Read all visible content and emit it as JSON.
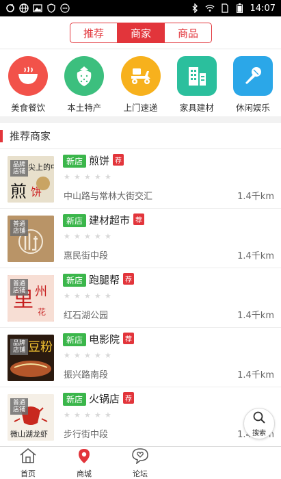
{
  "status_bar": {
    "time": "14:07",
    "left_icons": [
      "sync-icon",
      "globe-icon",
      "image-icon",
      "shield-icon",
      "more-icon"
    ],
    "right_icons": [
      "bluetooth-icon",
      "wifi-icon",
      "sim-icon",
      "battery-icon"
    ]
  },
  "segments": {
    "items": [
      {
        "label": "推荐",
        "active": false
      },
      {
        "label": "商家",
        "active": true
      },
      {
        "label": "商品",
        "active": false
      }
    ]
  },
  "categories": [
    {
      "label": "美食餐饮",
      "icon": "bowl-icon",
      "color": "#f2524a"
    },
    {
      "label": "本土特产",
      "icon": "strawberry-icon",
      "color": "#3cbf7e"
    },
    {
      "label": "上门速递",
      "icon": "scooter-icon",
      "color": "#f7b11d"
    },
    {
      "label": "家具建材",
      "icon": "building-icon",
      "color": "#2bbf9d"
    },
    {
      "label": "休闲娱乐",
      "icon": "microphone-icon",
      "color": "#2ba7e8"
    }
  ],
  "section": {
    "title": "推荐商家"
  },
  "merchants": [
    {
      "tag": "品牌店铺",
      "new": "新店",
      "name": "煎饼",
      "rec": "荐",
      "address": "中山路与常林大街交汇",
      "distance": "1.4千km",
      "thumb_color": "#d9cfb8"
    },
    {
      "tag": "普通店铺",
      "new": "新店",
      "name": "建材超市",
      "rec": "荐",
      "address": "惠民街中段",
      "distance": "1.4千km",
      "thumb_color": "#b99467"
    },
    {
      "tag": "普通店铺",
      "new": "新店",
      "name": "跑腿帮",
      "rec": "荐",
      "address": "红石湖公园",
      "distance": "1.4千km",
      "thumb_color": "#c61f1f"
    },
    {
      "tag": "品牌店铺",
      "new": "新店",
      "name": "电影院",
      "rec": "荐",
      "address": "振兴路南段",
      "distance": "1.4千km",
      "thumb_color": "#7a4a26"
    },
    {
      "tag": "普通店铺",
      "new": "新店",
      "name": "火锅店",
      "rec": "荐",
      "address": "步行街中段",
      "distance": "1.4千km",
      "thumb_color": "#efe7dd"
    }
  ],
  "fab": {
    "label": "搜索"
  },
  "tabbar": [
    {
      "label": "首页",
      "icon": "home-icon",
      "active": false
    },
    {
      "label": "商城",
      "icon": "location-pin-icon",
      "active": true
    },
    {
      "label": "论坛",
      "icon": "chat-heart-icon",
      "active": false
    }
  ],
  "colors": {
    "accent": "#e2353b",
    "new_badge": "#3bb64b"
  }
}
